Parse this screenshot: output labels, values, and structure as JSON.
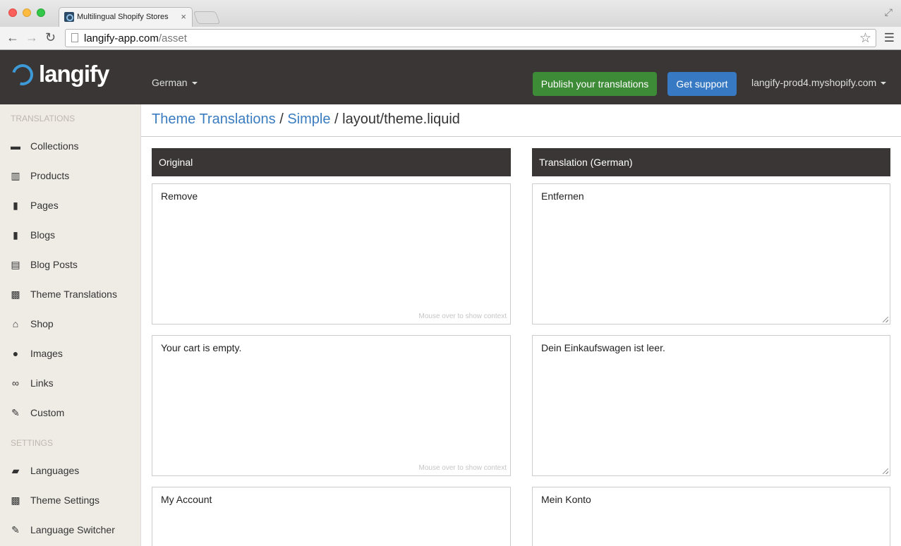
{
  "browser": {
    "tab_title": "Multilingual Shopify Stores",
    "url_host": "langify-app.com",
    "url_path": "/asset"
  },
  "header": {
    "logo_text": "langify",
    "language": "German",
    "publish_label": "Publish your translations",
    "support_label": "Get support",
    "shop": "langify-prod4.myshopify.com"
  },
  "sidebar": {
    "translations_heading": "TRANSLATIONS",
    "settings_heading": "SETTINGS",
    "items": [
      {
        "label": "Collections",
        "icon": "folder-icon"
      },
      {
        "label": "Products",
        "icon": "barcode-icon"
      },
      {
        "label": "Pages",
        "icon": "file-icon"
      },
      {
        "label": "Blogs",
        "icon": "book-icon"
      },
      {
        "label": "Blog Posts",
        "icon": "list-icon"
      },
      {
        "label": "Theme Translations",
        "icon": "picture-icon"
      },
      {
        "label": "Shop",
        "icon": "home-icon"
      },
      {
        "label": "Images",
        "icon": "drop-icon"
      },
      {
        "label": "Links",
        "icon": "link-icon"
      },
      {
        "label": "Custom",
        "icon": "edit-icon"
      }
    ],
    "settings_items": [
      {
        "label": "Languages",
        "icon": "comment-icon"
      },
      {
        "label": "Theme Settings",
        "icon": "picture-icon"
      },
      {
        "label": "Language Switcher",
        "icon": "pencil-icon"
      }
    ]
  },
  "breadcrumb": {
    "part1": "Theme Translations",
    "sep1": "/",
    "part2": "Simple",
    "sep2": "/",
    "part3": "layout/theme.liquid"
  },
  "columns": {
    "original": "Original",
    "translation": "Translation (German)"
  },
  "context_hint": "Mouse over to show context",
  "rows": [
    {
      "original": "Remove",
      "translation": "Entfernen"
    },
    {
      "original": "Your cart is empty.",
      "translation": "Dein Einkaufswagen ist leer."
    },
    {
      "original": "My Account",
      "translation": "Mein Konto"
    }
  ]
}
